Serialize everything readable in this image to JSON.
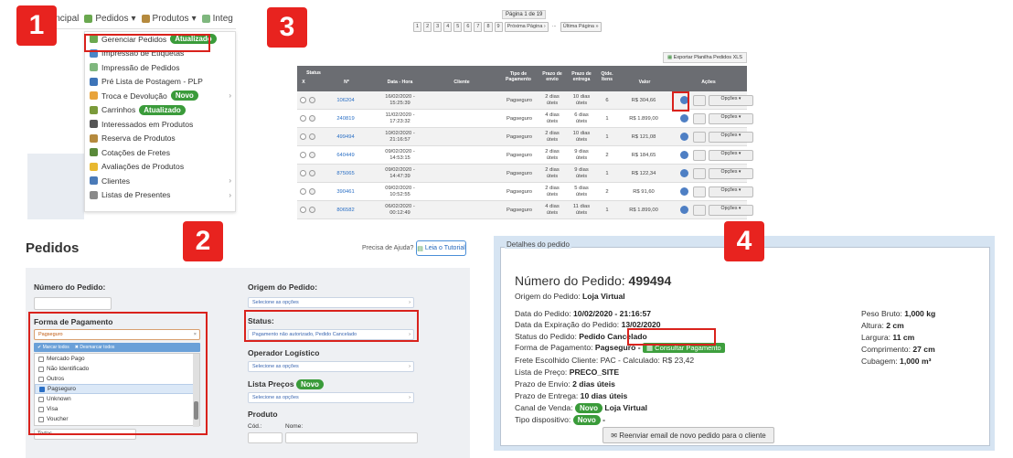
{
  "badges": [
    "1",
    "2",
    "3",
    "4"
  ],
  "panel1": {
    "topnav": {
      "item1": "incipal",
      "item2": "Pedidos",
      "item3": "Produtos",
      "item4": "Integ"
    },
    "menu_items": [
      {
        "label": "Gerenciar Pedidos",
        "badge": "Atualizado",
        "arrow": "",
        "color": "#6aa84f"
      },
      {
        "label": "Impressão de Etiquetas",
        "badge": "",
        "arrow": "",
        "color": "#4a86c8"
      },
      {
        "label": "Impressão de Pedidos",
        "badge": "",
        "arrow": "",
        "color": "#7fb77e"
      },
      {
        "label": "Pré Lista de Postagem - PLP",
        "badge": "",
        "arrow": "",
        "color": "#3d74b8"
      },
      {
        "label": "Troca e Devolução",
        "badge": "Novo",
        "arrow": "›",
        "color": "#e8a33a"
      },
      {
        "label": "Carrinhos",
        "badge": "Atualizado",
        "arrow": "",
        "color": "#7a9a3a"
      },
      {
        "label": "Interessados em Produtos",
        "badge": "",
        "arrow": "",
        "color": "#555555"
      },
      {
        "label": "Reserva de Produtos",
        "badge": "",
        "arrow": "",
        "color": "#b58a3e"
      },
      {
        "label": "Cotações de Fretes",
        "badge": "",
        "arrow": "",
        "color": "#5a8a3a"
      },
      {
        "label": "Avaliações de Produtos",
        "badge": "",
        "arrow": "",
        "color": "#e8b830"
      },
      {
        "label": "Clientes",
        "badge": "",
        "arrow": "›",
        "color": "#4a7ab8"
      },
      {
        "label": "Listas de Presentes",
        "badge": "",
        "arrow": "›",
        "color": "#8a8a8a"
      }
    ]
  },
  "panel2": {
    "title": "Pedidos",
    "help": "Precisa de Ajuda?",
    "tutorial": "Leia o Tutorial",
    "numero_label": "Número do Pedido:",
    "forma_label": "Forma de Pagamento",
    "forma_value": "Pagseguro",
    "marcar": "✔ Marcar todos",
    "desmarcar": "✖ Desmarcar todos",
    "options": [
      {
        "label": "Mercado Pago",
        "checked": false
      },
      {
        "label": "Não Identificado",
        "checked": false
      },
      {
        "label": "Outros",
        "checked": false
      },
      {
        "label": "Pagseguro",
        "checked": true
      },
      {
        "label": "Unknown",
        "checked": false
      },
      {
        "label": "Visa",
        "checked": false
      },
      {
        "label": "Voucher",
        "checked": false
      }
    ],
    "todas": "Todas",
    "origem_label": "Origem do Pedido:",
    "origem_value": "Selecione as opções",
    "status_label": "Status:",
    "status_value": "Pagamento não autorizado, Pedido Cancelado",
    "operador_label": "Operador Logístico",
    "operador_value": "Selecione as opções",
    "lista_label": "Lista Preços",
    "lista_badge": "Novo",
    "lista_value": "Selecione as opções",
    "produto_label": "Produto",
    "cod_label": "Cód.:",
    "nome_label": "Nome:"
  },
  "panel3": {
    "page_label": "Página 1 de 19",
    "pages": [
      "1",
      "2",
      "3",
      "4",
      "5",
      "6",
      "7",
      "8",
      "9",
      "Próxima Página ›",
      "...",
      "Última Página »"
    ],
    "xls": "Exportar Planilha Pedidos XLS",
    "headers": {
      "status": "Status",
      "x": "X",
      "num": "Nº",
      "data": "Data - Hora",
      "cliente": "Cliente",
      "tipo": "Tipo de Pagamento",
      "prazo_envio": "Prazo de envio",
      "prazo_entrega": "Prazo de entrega",
      "qtde": "Qtde. Itens",
      "valor": "Valor",
      "acoes": "Ações"
    },
    "opcoes": "Opções ▾",
    "rows": [
      {
        "num": "106204",
        "data": "16/02/2020 - 15:25:39",
        "tipo": "Pagseguro",
        "envio": "2 dias úteis",
        "entrega": "10 dias úteis",
        "qtde": "6",
        "valor": "R$ 304,66"
      },
      {
        "num": "240819",
        "data": "11/02/2020 - 17:23:32",
        "tipo": "Pagseguro",
        "envio": "4 dias úteis",
        "entrega": "6 dias úteis",
        "qtde": "1",
        "valor": "R$ 1.899,00"
      },
      {
        "num": "499494",
        "data": "10/02/2020 - 21:16:57",
        "tipo": "Pagseguro",
        "envio": "2 dias úteis",
        "entrega": "10 dias úteis",
        "qtde": "1",
        "valor": "R$ 121,08"
      },
      {
        "num": "640449",
        "data": "09/02/2020 - 14:53:15",
        "tipo": "Pagseguro",
        "envio": "2 dias úteis",
        "entrega": "9 dias úteis",
        "qtde": "2",
        "valor": "R$ 184,65"
      },
      {
        "num": "875065",
        "data": "09/02/2020 - 14:47:39",
        "tipo": "Pagseguro",
        "envio": "2 dias úteis",
        "entrega": "9 dias úteis",
        "qtde": "1",
        "valor": "R$ 122,34"
      },
      {
        "num": "390461",
        "data": "09/02/2020 - 10:52:55",
        "tipo": "Pagseguro",
        "envio": "2 dias úteis",
        "entrega": "5 dias úteis",
        "qtde": "2",
        "valor": "R$ 91,60"
      },
      {
        "num": "806582",
        "data": "06/02/2020 - 00:12:49",
        "tipo": "Pagseguro",
        "envio": "4 dias úteis",
        "entrega": "11 dias úteis",
        "qtde": "1",
        "valor": "R$ 1.899,00"
      }
    ]
  },
  "panel4": {
    "legend": "Detalhes do pedido",
    "title_prefix": "Número do Pedido:",
    "title_num": "499494",
    "origem": {
      "k": "Origem do Pedido:",
      "v": "Loja Virtual"
    },
    "data_pedido": {
      "k": "Data do Pedido:",
      "v": "10/02/2020 - 21:16:57"
    },
    "data_exp": {
      "k": "Data da Expiração do Pedido:",
      "v": "13/02/2020"
    },
    "status": {
      "k": "Status do Pedido:",
      "v": "Pedido Cancelado"
    },
    "forma": {
      "k": "Forma de Pagamento:",
      "v": "Pagseguro -"
    },
    "consultar": "Consultar Pagamento",
    "frete": {
      "k": "Frete Escolhido Cliente:",
      "v": "PAC - Calculado: R$ 23,42"
    },
    "lista": {
      "k": "Lista de Preço:",
      "v": "PRECO_SITE"
    },
    "prazo_envio": {
      "k": "Prazo de Envio:",
      "v": "2 dias úteis"
    },
    "prazo_entrega": {
      "k": "Prazo de Entrega:",
      "v": "10 dias úteis"
    },
    "canal": {
      "k": "Canal de Venda:",
      "badge": "Novo",
      "v": "Loja Virtual"
    },
    "tipo_disp": {
      "k": "Tipo dispositivo:",
      "badge": "Novo",
      "v": "-"
    },
    "peso": {
      "k": "Peso Bruto:",
      "v": "1,000 kg"
    },
    "altura": {
      "k": "Altura:",
      "v": "2 cm"
    },
    "largura": {
      "k": "Largura:",
      "v": "11 cm"
    },
    "comprimento": {
      "k": "Comprimento:",
      "v": "27 cm"
    },
    "cubagem": {
      "k": "Cubagem:",
      "v": "1,000 m³"
    },
    "resend": "Reenviar email de novo pedido para o cliente"
  }
}
